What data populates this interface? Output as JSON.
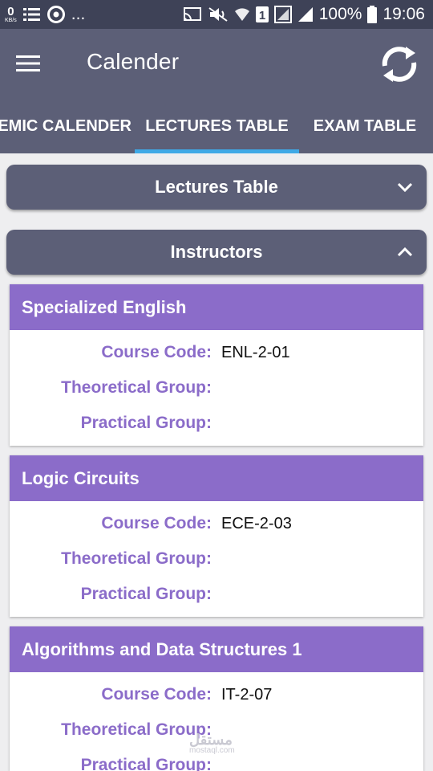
{
  "status_bar": {
    "speed_value": "0",
    "speed_unit": "KB/s",
    "more": "...",
    "sim_number": "1",
    "battery": "100%",
    "time": "19:06"
  },
  "app_bar": {
    "title": "Calender",
    "tabs": [
      {
        "label": "ACADEMIC CALENDER",
        "visible_label": "EMIC CALENDER"
      },
      {
        "label": "LECTURES TABLE",
        "visible_label": "LECTURES TABLE",
        "selected": true
      },
      {
        "label": "EXAM TABLE",
        "visible_label": "EXAM TABLE"
      }
    ]
  },
  "sections": [
    {
      "title": "Lectures Table",
      "expanded": false
    },
    {
      "title": "Instructors",
      "expanded": true
    }
  ],
  "labels": {
    "course_code": "Course Code:",
    "theoretical_group": "Theoretical Group:",
    "practical_group": "Practical Group:"
  },
  "courses": [
    {
      "name": "Specialized English",
      "course_code": "ENL-2-01",
      "theoretical_group": "",
      "practical_group": ""
    },
    {
      "name": "Logic Circuits",
      "course_code": "ECE-2-03",
      "theoretical_group": "",
      "practical_group": ""
    },
    {
      "name": "Algorithms and Data Structures 1",
      "course_code": "IT-2-07",
      "theoretical_group": "",
      "practical_group": ""
    }
  ],
  "watermark": {
    "text": "مستقل",
    "sub": "mostaql.com"
  },
  "colors": {
    "status_bar": "#3e4257",
    "app_bar": "#5c5f77",
    "accent_tab": "#3fa9e6",
    "card_header": "#8b6cc9"
  }
}
